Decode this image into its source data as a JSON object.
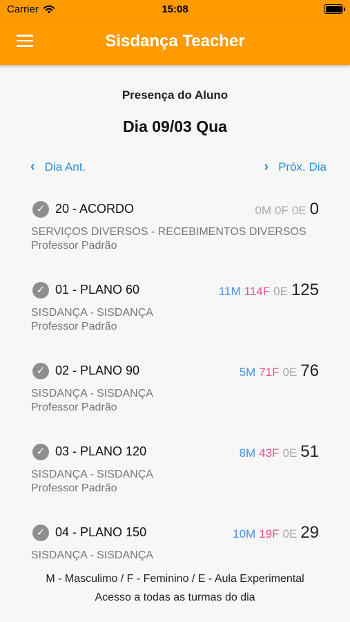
{
  "status_bar": {
    "carrier": "Carrier",
    "time": "15:08"
  },
  "app_bar": {
    "title": "Sisdança Teacher"
  },
  "header": {
    "subtitle": "Presença do Aluno",
    "day": "Dia 09/03 Qua"
  },
  "navigation": {
    "prev_label": "Dia Ant.",
    "next_label": "Próx. Dia"
  },
  "classes": [
    {
      "name": "20 - ACORDO",
      "m": "0M",
      "f": "0F",
      "e": "0E",
      "total": "0",
      "description": "SERVIÇOS DIVERSOS - RECEBIMENTOS DIVERSOS",
      "professor": "Professor Padrão"
    },
    {
      "name": "01 - PLANO 60",
      "m": "11M",
      "f": "114F",
      "e": "0E",
      "total": "125",
      "description": "SISDANÇA - SISDANÇA",
      "professor": "Professor Padrão"
    },
    {
      "name": "02 - PLANO 90",
      "m": "5M",
      "f": "71F",
      "e": "0E",
      "total": "76",
      "description": "SISDANÇA - SISDANÇA",
      "professor": "Professor Padrão"
    },
    {
      "name": "03 - PLANO 120",
      "m": "8M",
      "f": "43F",
      "e": "0E",
      "total": "51",
      "description": "SISDANÇA - SISDANÇA",
      "professor": "Professor Padrão"
    },
    {
      "name": "04 - PLANO 150",
      "m": "10M",
      "f": "19F",
      "e": "0E",
      "total": "29",
      "description": "SISDANÇA - SISDANÇA",
      "professor": ""
    }
  ],
  "legend": "M - Masculimo / F - Feminino / E - Aula Experimental",
  "footer": "Acesso a todas as turmas do dia",
  "colors": {
    "brand": "#ff9a00",
    "link": "#2a8fd8",
    "male": "#4a90e2",
    "female": "#e8508a",
    "muted": "#a8a8a8"
  }
}
